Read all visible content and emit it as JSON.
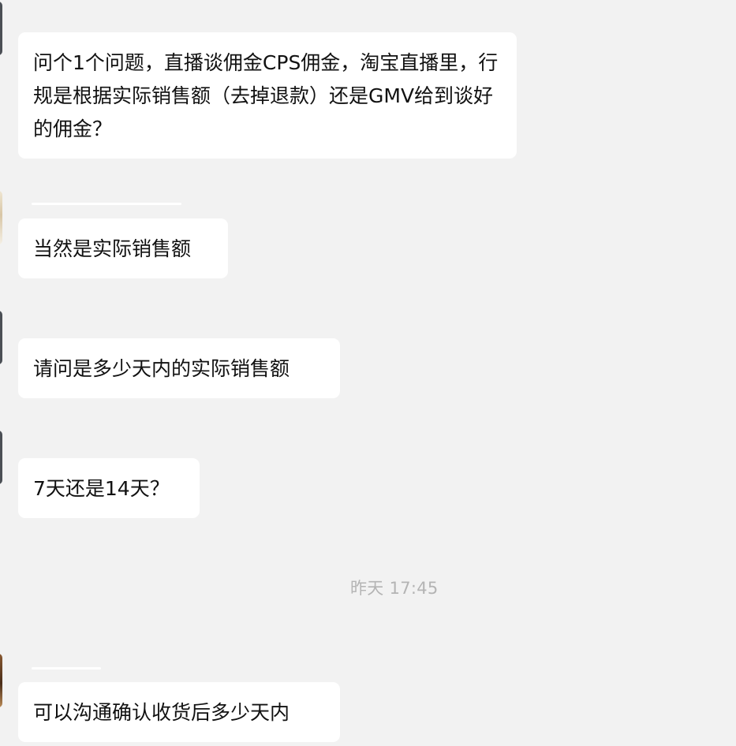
{
  "chat": {
    "messages": [
      {
        "text": "问个1个问题，直播谈佣金CPS佣金，淘宝直播里，行规是根据实际销售额（去掉退款）还是GMV给到谈好的佣金？"
      },
      {
        "text": "当然是实际销售额"
      },
      {
        "text": "请问是多少天内的实际销售额"
      },
      {
        "text": "7天还是14天？"
      },
      {
        "text": "可以沟通确认收货后多少天内"
      }
    ],
    "timestamp": "昨天 17:45"
  }
}
